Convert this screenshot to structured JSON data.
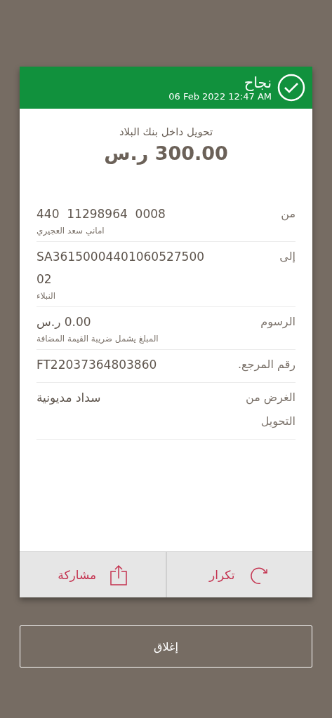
{
  "header": {
    "status": "نجاح",
    "datetime": "06 Feb 2022 12:47 AM"
  },
  "transfer": {
    "type": "تحويل داخل بنك البلاد",
    "amount": "300.00 ر.س"
  },
  "details": [
    {
      "label": "من",
      "value_lines": [
        "440  11298964  0008"
      ],
      "note": "اماني سعد العجيري"
    },
    {
      "label": "إلى",
      "value_lines": [
        "SA36150004401060527500",
        "02"
      ],
      "note": "النبلاء"
    },
    {
      "label": "الرسوم",
      "value_lines": [
        "0.00 ر.س"
      ],
      "note": "المبلغ يشمل ضريبة القيمة المضافة"
    },
    {
      "label": "رقم المرجع.",
      "value_lines": [
        "FT22037364803860"
      ]
    },
    {
      "label": "الغرض من التحويل",
      "value_lines": [
        "سداد مديونية"
      ]
    }
  ],
  "actions": [
    {
      "kind": "repeat",
      "label": "تكرار"
    },
    {
      "kind": "share",
      "label": "مشاركة"
    }
  ],
  "close_button": "إغلاق"
}
